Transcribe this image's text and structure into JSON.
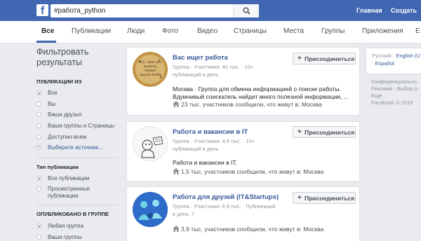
{
  "topbar": {
    "logo": "f",
    "search_value": "#работа_python",
    "links": [
      "Главная",
      "Создать"
    ]
  },
  "tabs": [
    "Все",
    "Публикации",
    "Люди",
    "Фото",
    "Видео",
    "Страницы",
    "Места",
    "Группы",
    "Приложения",
    "Е"
  ],
  "filters": {
    "title": "Фильтровать результаты",
    "sections": [
      {
        "title": "ПУБЛИКАЦИИ ИЗ",
        "options": [
          "Все",
          "Вы",
          "Ваши друзья",
          "Ваши группы и Страницы",
          "Доступно всем",
          "Выберите источник..."
        ],
        "selected": 0
      },
      {
        "title": "Тип публикации",
        "options": [
          "Все публикации",
          "Просмотренные публикации"
        ],
        "selected": 0
      },
      {
        "title": "ОПУБЛИКОВАНО В ГРУППЕ",
        "options": [
          "Любая группа",
          "Ваши группы"
        ],
        "selected": 0
      }
    ]
  },
  "results": [
    {
      "name": "Вас ищет работа",
      "meta": "Группа · Участники: 40 тыс. · 10+ публикаций в день",
      "desc": "Москва · Группа для обмена информацией о поиске работы. Вдумчивый соискатель найдет много полезной информации, ...",
      "stat": "23 тыс. участников сообщили, что живут в: Москва",
      "join": "Присоединиться",
      "avatar_text": "Ты, что мы искали, тоже ищем тебя"
    },
    {
      "name": "Работа и вакансии в IT",
      "meta": "Группа · Участники: 4,6 тыс. · 10+ публикаций в день",
      "desc": "Работа и вакансии в IT.",
      "stat": "1,5 тыс. участников сообщили, что живут в: Москва",
      "join": "Присоединиться"
    },
    {
      "name": "Работа для друзей (IT&Startups)",
      "meta": "Группа · Участники: 6,9 тыс. · Публикаций в день: 7",
      "desc": "",
      "stat": "3,9 тыс. участников сообщили, что живут в: Москва",
      "join": "Присоединиться"
    }
  ],
  "right": {
    "lang_prefix": "Русский · ",
    "lang_english": "English (U",
    "lang_spanish": "Español",
    "footer_lines": [
      "Конфиденциально",
      "Реклама · Выбор р",
      "Ещё ·",
      "Facebook © 2019"
    ]
  },
  "colors": {
    "brand": "#4267b2",
    "link": "#365899"
  }
}
